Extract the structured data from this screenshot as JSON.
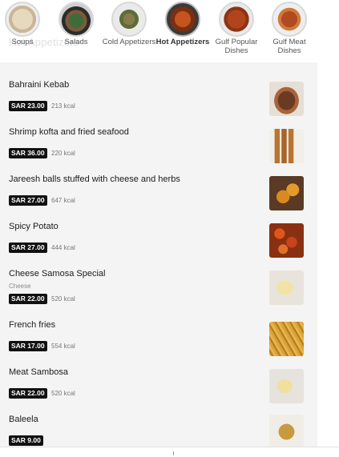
{
  "categories": [
    {
      "label": "Soups",
      "active": false
    },
    {
      "label": "Salads",
      "active": false
    },
    {
      "label": "Cold Appetizers",
      "active": false
    },
    {
      "label": "Hot Appetizers",
      "active": true
    },
    {
      "label": "Gulf Popular Dishes",
      "active": false
    },
    {
      "label": "Gulf Meat Dishes",
      "active": false
    }
  ],
  "ghost_heading": "Hot Appetizers",
  "items": [
    {
      "name": "Bahraini Kebab",
      "subtitle": "",
      "price": "SAR 23.00",
      "kcal": "213 kcal",
      "photo": "grilled-kebab"
    },
    {
      "name": "Shrimp kofta and fried seafood",
      "subtitle": "",
      "price": "SAR 36.00",
      "kcal": "220 kcal",
      "photo": "fried-kofta"
    },
    {
      "name": "Jareesh balls stuffed with cheese and herbs",
      "subtitle": "",
      "price": "SAR 27.00",
      "kcal": "647 kcal",
      "photo": "fried-balls"
    },
    {
      "name": "Spicy Potato",
      "subtitle": "",
      "price": "SAR 27.00",
      "kcal": "444 kcal",
      "photo": "spicy-potato"
    },
    {
      "name": "Cheese Samosa Special",
      "subtitle": "Cheese",
      "price": "SAR 22.00",
      "kcal": "520 kcal",
      "photo": "samosa"
    },
    {
      "name": "French fries",
      "subtitle": "",
      "price": "SAR 17.00",
      "kcal": "554 kcal",
      "photo": "fries"
    },
    {
      "name": "Meat Sambosa",
      "subtitle": "",
      "price": "SAR 22.00",
      "kcal": "520 kcal",
      "photo": "samosa"
    },
    {
      "name": "Baleela",
      "subtitle": "",
      "price": "SAR 9.00",
      "kcal": "",
      "photo": "chickpeas"
    }
  ]
}
